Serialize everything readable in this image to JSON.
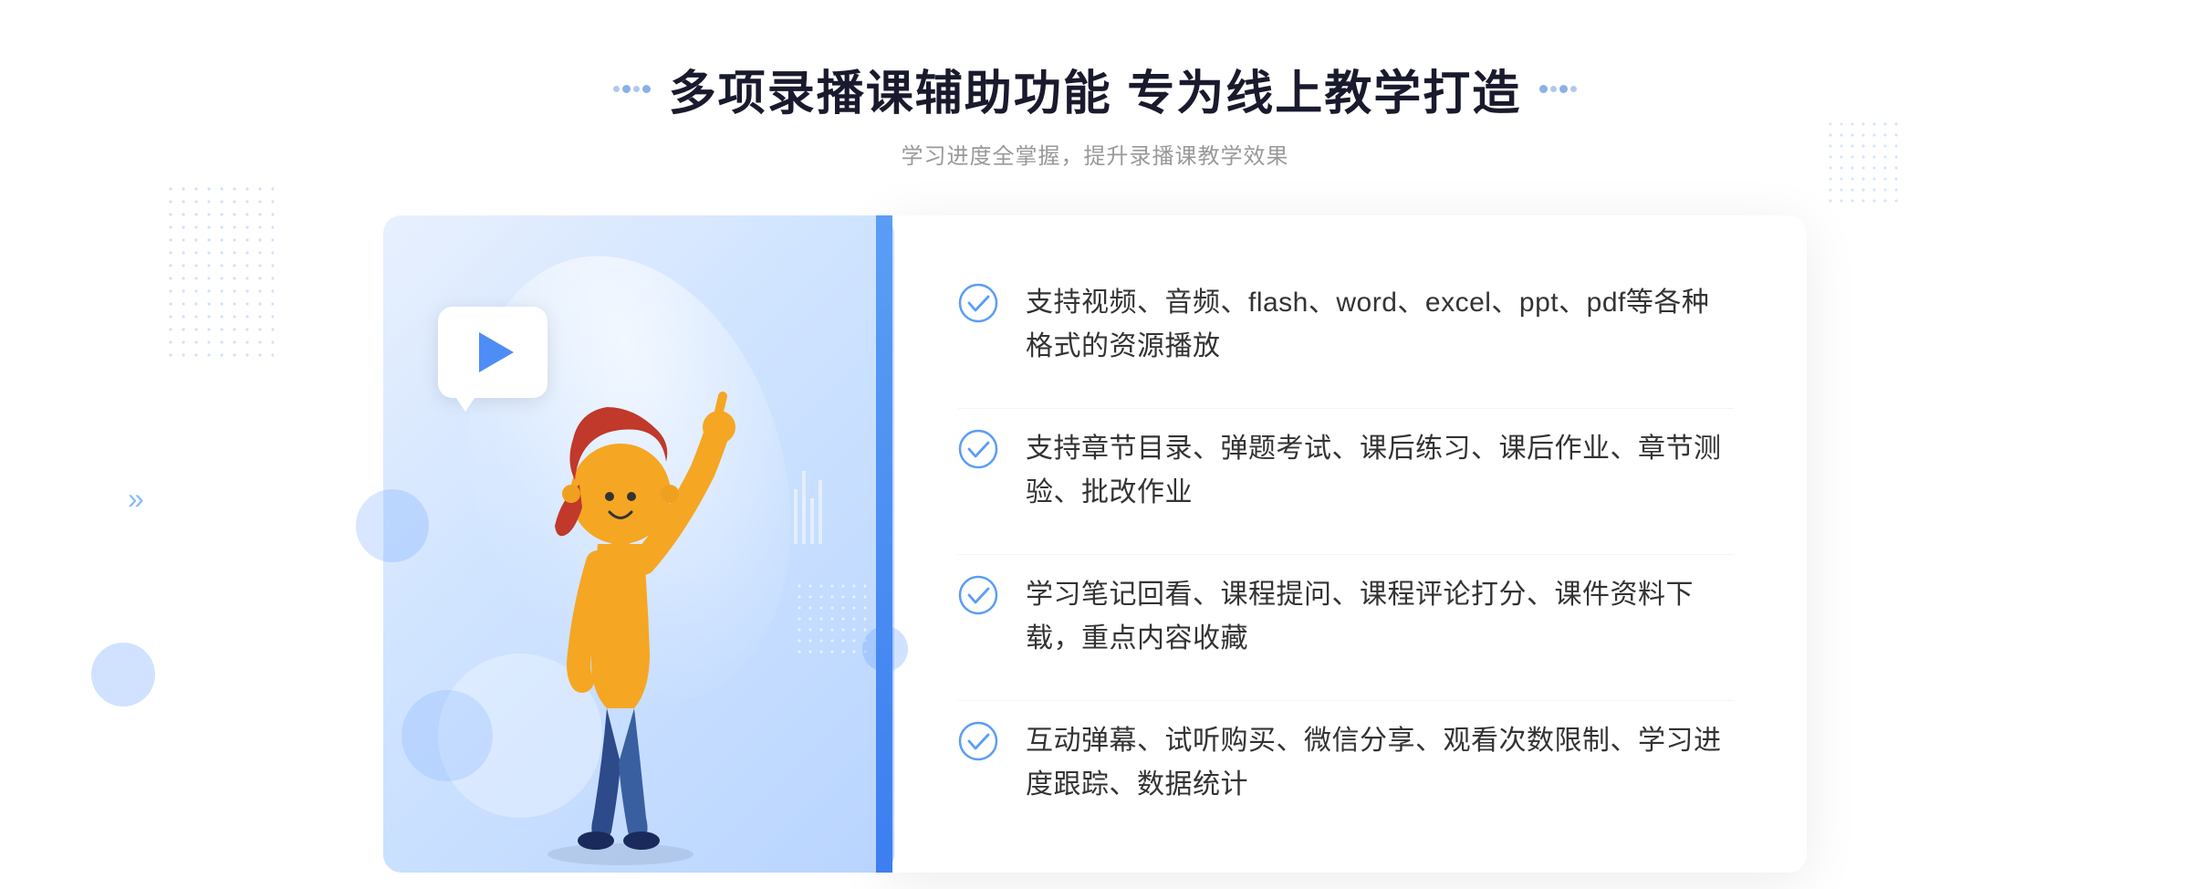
{
  "header": {
    "title": "多项录播课辅助功能 专为线上教学打造",
    "subtitle": "学习进度全掌握，提升录播课教学效果"
  },
  "features": [
    {
      "id": 1,
      "text": "支持视频、音频、flash、word、excel、ppt、pdf等各种格式的资源播放"
    },
    {
      "id": 2,
      "text": "支持章节目录、弹题考试、课后练习、课后作业、章节测验、批改作业"
    },
    {
      "id": 3,
      "text": "学习笔记回看、课程提问、课程评论打分、课件资料下载，重点内容收藏"
    },
    {
      "id": 4,
      "text": "互动弹幕、试听购买、微信分享、观看次数限制、学习进度跟踪、数据统计"
    }
  ],
  "icons": {
    "check": "check-circle",
    "play": "▶",
    "arrow_left": "»",
    "arrow_right": "»"
  }
}
